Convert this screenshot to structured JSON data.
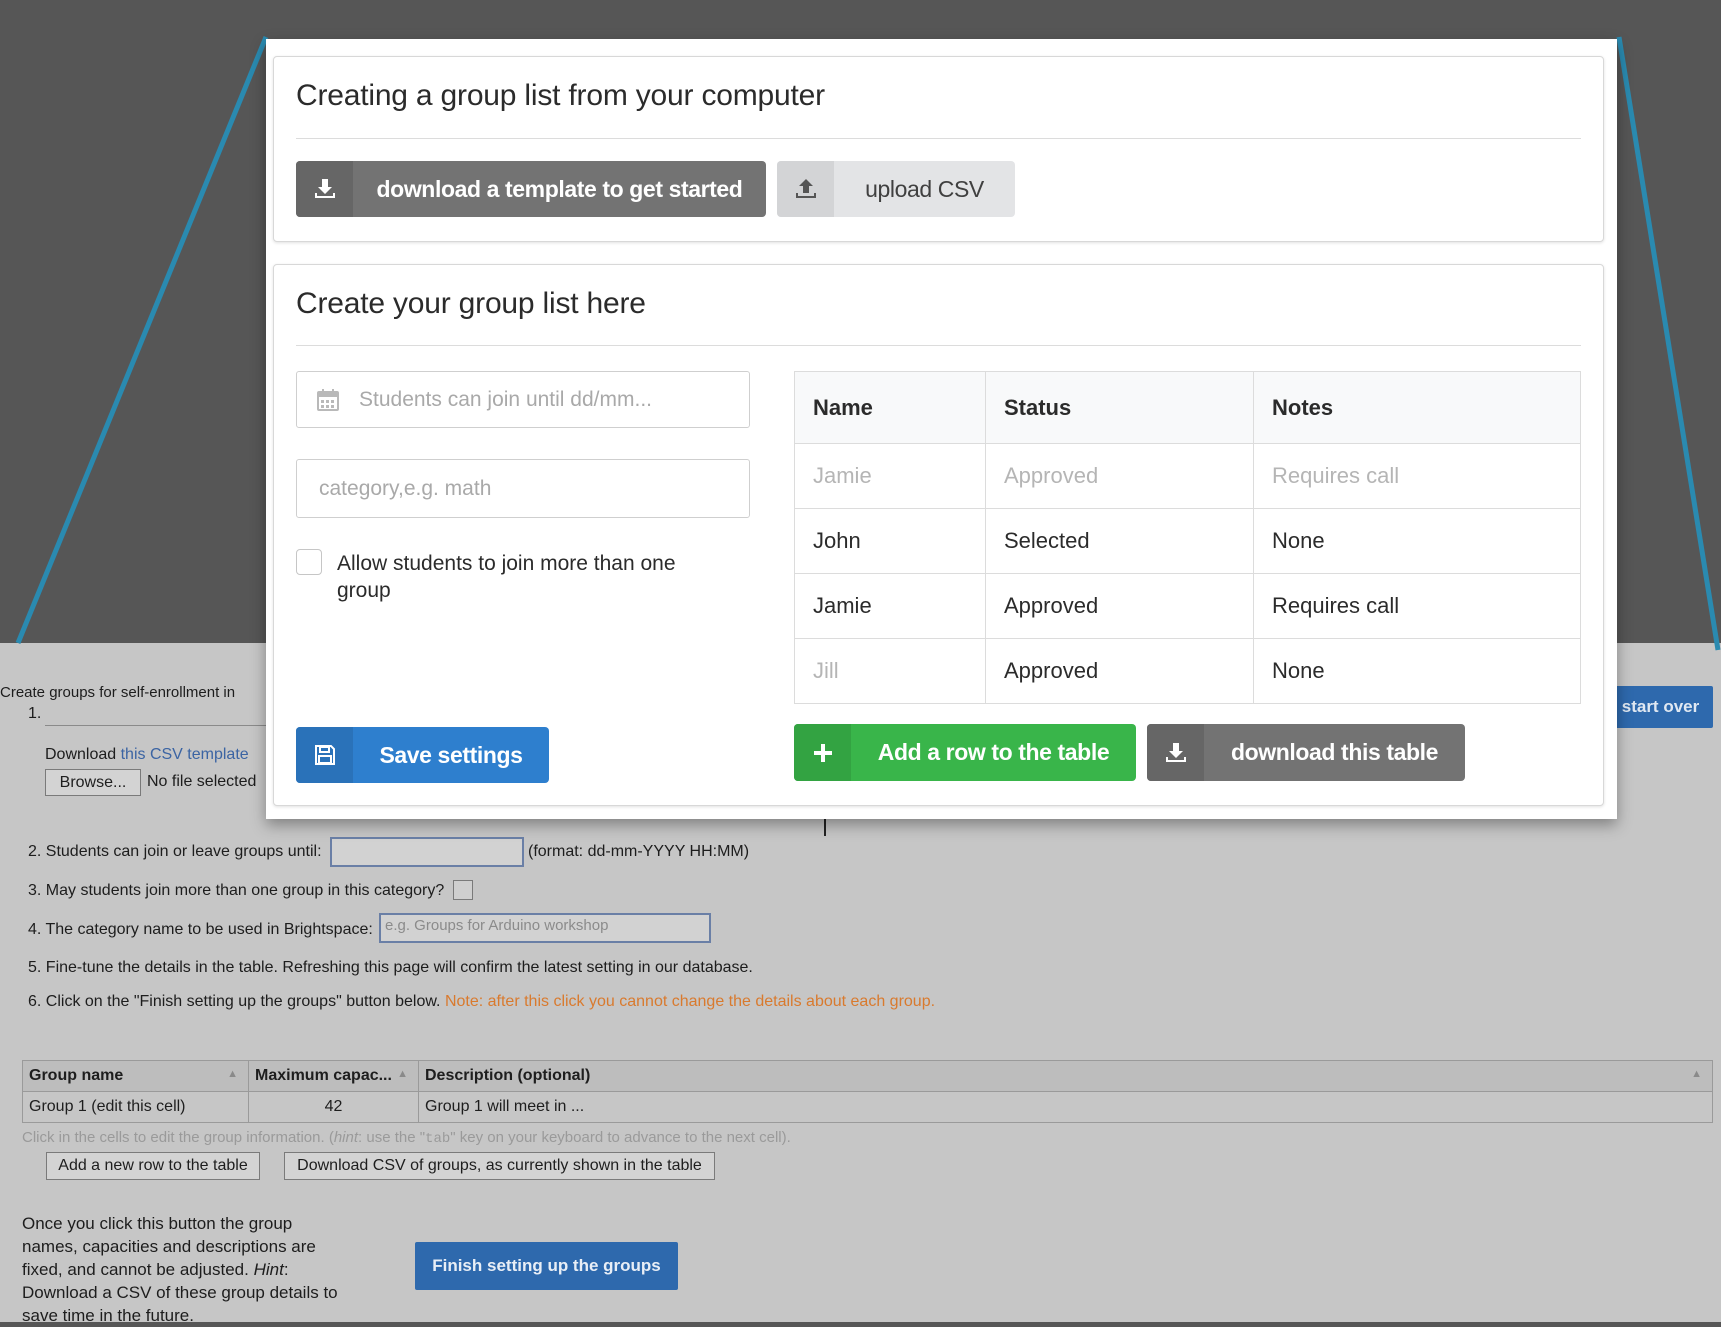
{
  "modal": {
    "upload_section": {
      "title": "Creating a group list from your computer",
      "download_template_label": "download a template to get started",
      "upload_csv_label": "upload CSV"
    },
    "create_section": {
      "title": "Create your group list here",
      "date_placeholder": "Students can join until dd/mm...",
      "category_placeholder": "category,e.g. math",
      "allow_multiple_label": "Allow students to join more than one group",
      "save_label": "Save settings",
      "table": {
        "headers": [
          "Name",
          "Status",
          "Notes"
        ],
        "rows": [
          [
            "Jamie",
            "Approved",
            "Requires call"
          ],
          [
            "John",
            "Selected",
            "None"
          ],
          [
            "Jamie",
            "Approved",
            "Requires call"
          ],
          [
            "Jill",
            "Approved",
            "None"
          ]
        ]
      },
      "add_row_label": "Add a row to the table",
      "download_table_label": "download this table"
    }
  },
  "background": {
    "intro": "Create groups for self-enrollment in",
    "step1_num": "1.",
    "download_text": "Download",
    "csv_link": "this CSV template",
    "browse_label": "Browse...",
    "no_file": "No file selected",
    "step2": "2. Students can join or leave groups until:",
    "step2_format": "(format: dd-mm-YYYY HH:MM)",
    "step3": "3. May students join more than one group in this category?",
    "step4": "4. The category name to be used in Brightspace:",
    "step4_placeholder": "e.g. Groups for Arduino workshop",
    "step5": "5. Fine-tune the details in the table. Refreshing this page will confirm the latest setting in our database.",
    "step6": "6. Click on the \"Finish setting up the groups\" button below.",
    "step6_note": "Note: after this click you cannot change the details about each group.",
    "table": {
      "headers": [
        "Group name",
        "Maximum capac...",
        "Description (optional)"
      ],
      "row": [
        "Group 1 (edit this cell)",
        "42",
        "Group 1 will meet in ..."
      ]
    },
    "hint_a": "Click in the cells to edit the group information. (",
    "hint_b": "hint",
    "hint_c": ": use the \"",
    "hint_key": "tab",
    "hint_d": "\" key on your keyboard to advance to the next cell).",
    "add_row_label": "Add a new row to the table",
    "download_csv_label": "Download CSV of groups, as currently shown in the table",
    "once_text_1": "Once you click this button the group",
    "once_text_2": "names, capacities and descriptions are",
    "once_text_3": "fixed, and cannot be adjusted.",
    "once_hint": "Hint",
    "once_text_4": ":",
    "once_text_5": "Download a CSV of these group details to",
    "once_text_6": "save time in the future.",
    "finish_label": "Finish setting up the groups",
    "start_over_label": "start over"
  },
  "colors": {
    "accent_blue": "#2e7fce",
    "accent_green": "#39b54a",
    "zoom_line": "#2a8ab0",
    "note_orange": "#d97a2e"
  }
}
